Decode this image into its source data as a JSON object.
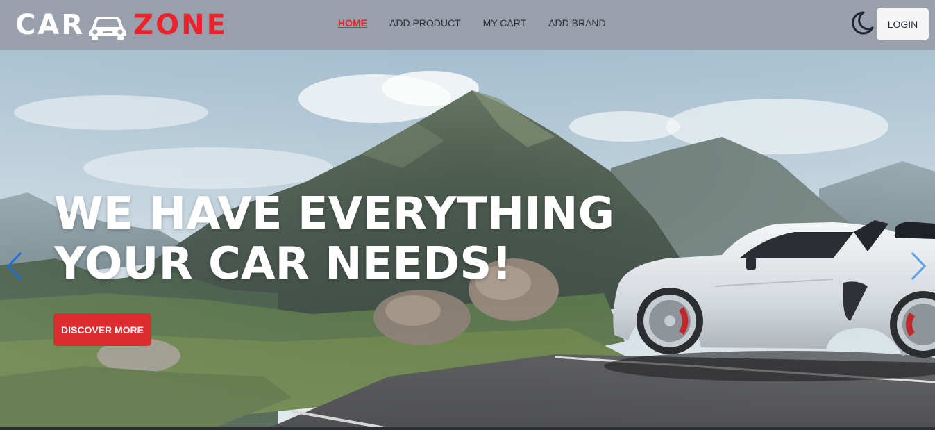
{
  "brand": {
    "part1": "CAR",
    "part2": "ZONE",
    "accent_color": "#e8232b"
  },
  "nav": {
    "items": [
      {
        "label": "HOME",
        "active": true
      },
      {
        "label": "ADD PRODUCT",
        "active": false
      },
      {
        "label": "MY CART",
        "active": false
      },
      {
        "label": "ADD BRAND",
        "active": false
      }
    ]
  },
  "header": {
    "theme_toggle_icon": "moon-icon",
    "login_label": "LOGIN"
  },
  "hero": {
    "headline_line1": "WE HAVE EVERYTHING",
    "headline_line2": "YOUR CAR NEEDS!",
    "cta_label": "DISCOVER MORE",
    "cta_color": "#dc2c30",
    "prev_icon": "chevron-left-icon",
    "next_icon": "chevron-right-icon"
  }
}
